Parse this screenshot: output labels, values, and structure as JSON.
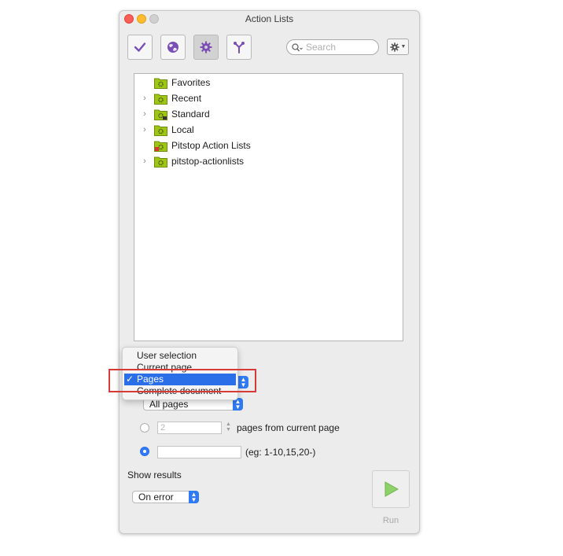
{
  "window": {
    "title": "Action Lists"
  },
  "toolbar": {
    "buttons": [
      {
        "name": "check-button",
        "icon": "checkmark-icon"
      },
      {
        "name": "globe-button",
        "icon": "globe-icon"
      },
      {
        "name": "gear-button",
        "icon": "gear-icon",
        "active": true
      },
      {
        "name": "branch-button",
        "icon": "branch-icon"
      }
    ],
    "search_placeholder": "Search",
    "action_menu_icon": "gear-icon"
  },
  "tree": {
    "items": [
      {
        "label": "Favorites",
        "expandable": false
      },
      {
        "label": "Recent",
        "expandable": true
      },
      {
        "label": "Standard",
        "expandable": true
      },
      {
        "label": "Local",
        "expandable": true
      },
      {
        "label": "Pitstop Action Lists",
        "expandable": false
      },
      {
        "label": "pitstop-actionlists",
        "expandable": true
      }
    ]
  },
  "scope_menu": {
    "options": [
      "User selection",
      "Current page",
      "Pages",
      "Complete document"
    ],
    "selected": "Pages",
    "checkmark": "✓"
  },
  "pages": {
    "selection": "All pages",
    "from_current_value": "2",
    "from_current_label": "pages from current page",
    "range_value": "",
    "range_hint": "(eg: 1-10,15,20-)"
  },
  "results": {
    "label": "Show results",
    "selection": "On error"
  },
  "run": {
    "label": "Run"
  },
  "colors": {
    "accent": "#2f7bf5",
    "highlight_border": "#d83a3a",
    "folder_green": "#9fc613",
    "run_triangle": "#8ed06a"
  }
}
